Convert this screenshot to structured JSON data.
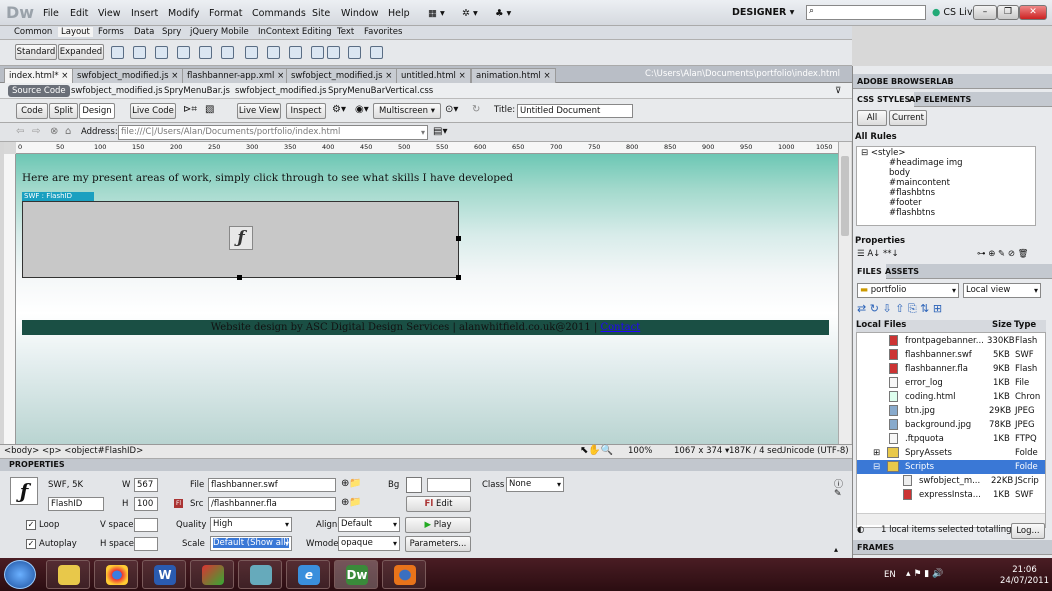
{
  "app": {
    "logo": "Dw",
    "workspace": "DESIGNER ▾",
    "cslive": "CS Live"
  },
  "menus": [
    "File",
    "Edit",
    "View",
    "Insert",
    "Modify",
    "Format",
    "Commands",
    "Site",
    "Window",
    "Help"
  ],
  "insert_tabs": [
    "Common",
    "Layout",
    "Forms",
    "Data",
    "Spry",
    "jQuery Mobile",
    "InContext Editing",
    "Text",
    "Favorites"
  ],
  "insert_tools": {
    "standard": "Standard",
    "expanded": "Expanded"
  },
  "doc_tabs": [
    "index.html*",
    "swfobject_modified.js",
    "flashbanner-app.xml",
    "swfobject_modified.js",
    "untitled.html",
    "animation.html"
  ],
  "doc_path": "C:\\Users\\Alan\\Documents\\portfolio\\index.html",
  "source_files": [
    "Source Code",
    "swfobject_modified.js",
    "SpryMenuBar.js",
    "swfobject_modified.js",
    "SpryMenuBarVertical.css"
  ],
  "view": {
    "code": "Code",
    "split": "Split",
    "design": "Design",
    "live_code": "Live Code",
    "live_view": "Live View",
    "inspect": "Inspect",
    "multiscreen": "Multiscreen ▾",
    "title_label": "Title:",
    "title_value": "Untitled Document"
  },
  "address": {
    "label": "Address:",
    "value": "file:///C|/Users/Alan/Documents/portfolio/index.html"
  },
  "ruler": [
    "0",
    "50",
    "100",
    "150",
    "200",
    "250",
    "300",
    "350",
    "400",
    "450",
    "500",
    "550",
    "600",
    "650",
    "700",
    "750",
    "800",
    "850",
    "900",
    "950",
    "1000",
    "1050"
  ],
  "page": {
    "headline": "Here are my present areas of work, simply click through to see what skills I have developed",
    "swf_label": "SWF : FlashID",
    "footer_text": "Website design by ASC Digital Design Services | alanwhitfield.co.uk@2011 | ",
    "footer_link": "Contact"
  },
  "status": {
    "tags": "<body> <p> <object#FlashID>",
    "zoom": "100%",
    "size": "1067 x 374 ▾",
    "weight": "187K / 4 sec",
    "encoding": "Unicode (UTF-8)"
  },
  "properties": {
    "header": "PROPERTIES",
    "type": "SWF, 5K",
    "id": "FlashID",
    "w_label": "W",
    "w": "567",
    "h_label": "H",
    "h": "100",
    "file_label": "File",
    "file": "flashbanner.swf",
    "src_label": "Src",
    "src": "/flashbanner.fla",
    "bg_label": "Bg",
    "edit": "Edit",
    "class_label": "Class",
    "class": "None",
    "loop": "Loop",
    "autoplay": "Autoplay",
    "vspace": "V space",
    "hspace": "H space",
    "quality_label": "Quality",
    "quality": "High",
    "scale_label": "Scale",
    "scale": "Default (Show all)",
    "align_label": "Align",
    "align": "Default",
    "wmode_label": "Wmode",
    "wmode": "opaque",
    "play": "Play",
    "parameters": "Parameters..."
  },
  "right_panel": {
    "browserlab": "ADOBE BROWSERLAB",
    "css_tabs": [
      "CSS STYLES",
      "AP ELEMENTS"
    ],
    "all": "All",
    "current": "Current",
    "all_rules": "All Rules",
    "rules": [
      "<style>",
      "#headimage img",
      "body",
      "#maincontent",
      "#flashbtns",
      "#footer",
      "#flashbtns"
    ],
    "properties": "Properties",
    "files_tabs": [
      "FILES",
      "ASSETS"
    ],
    "site": "portfolio",
    "view": "Local view",
    "col_local": "Local Files",
    "col_size": "Size",
    "col_type": "Type",
    "files": [
      {
        "name": "frontpagebanner...",
        "size": "330KB",
        "type": "Flash"
      },
      {
        "name": "flashbanner.swf",
        "size": "5KB",
        "type": "SWF"
      },
      {
        "name": "flashbanner.fla",
        "size": "9KB",
        "type": "Flash"
      },
      {
        "name": "error_log",
        "size": "1KB",
        "type": "File"
      },
      {
        "name": "coding.html",
        "size": "1KB",
        "type": "Chron"
      },
      {
        "name": "btn.jpg",
        "size": "29KB",
        "type": "JPEG"
      },
      {
        "name": "background.jpg",
        "size": "78KB",
        "type": "JPEG"
      },
      {
        "name": ".ftpquota",
        "size": "1KB",
        "type": "FTPQ"
      },
      {
        "name": "SpryAssets",
        "size": "",
        "type": "Folde"
      },
      {
        "name": "Scripts",
        "size": "",
        "type": "Folde"
      },
      {
        "name": "swfobject_m...",
        "size": "22KB",
        "type": "JScrip"
      },
      {
        "name": "expressInsta...",
        "size": "1KB",
        "type": "SWF"
      }
    ],
    "status": "1 local items selected totalling",
    "log": "Log...",
    "frames": "FRAMES"
  },
  "taskbar": {
    "lang": "EN",
    "time": "21:06",
    "date": "24/07/2011"
  }
}
